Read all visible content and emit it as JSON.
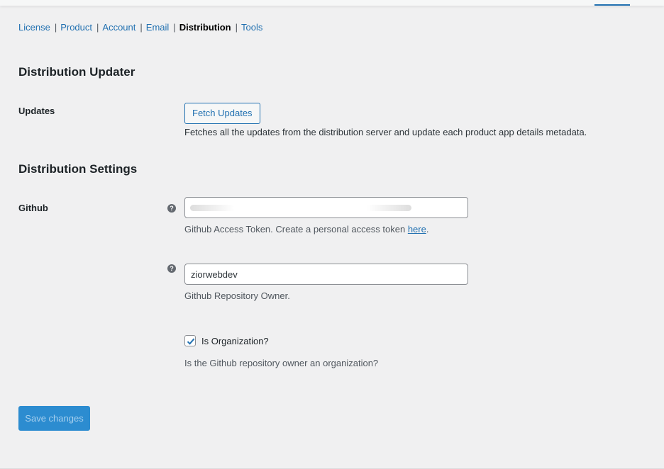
{
  "nav": {
    "items": [
      {
        "label": "License",
        "current": false
      },
      {
        "label": "Product",
        "current": false
      },
      {
        "label": "Account",
        "current": false
      },
      {
        "label": "Email",
        "current": false
      },
      {
        "label": "Distribution",
        "current": true
      },
      {
        "label": "Tools",
        "current": false
      }
    ],
    "separator": "|"
  },
  "updater": {
    "heading": "Distribution Updater",
    "updates_label": "Updates",
    "fetch_button": "Fetch Updates",
    "fetch_description": "Fetches all the updates from the distribution server and update each product app details metadata."
  },
  "settings": {
    "heading": "Distribution Settings",
    "github_label": "Github",
    "help_icon": "?",
    "token": {
      "value": "",
      "description_prefix": "Github Access Token. Create a personal access token ",
      "link_text": "here",
      "description_suffix": "."
    },
    "owner": {
      "value": "ziorwebdev",
      "description": "Github Repository Owner."
    },
    "organization": {
      "checked": true,
      "label": "Is Organization?",
      "description": "Is the Github repository owner an organization?"
    }
  },
  "footer": {
    "save_button": "Save changes"
  },
  "colors": {
    "link": "#2271b1",
    "primary_button": "#2c8cd0",
    "background": "#f0f0f1"
  }
}
